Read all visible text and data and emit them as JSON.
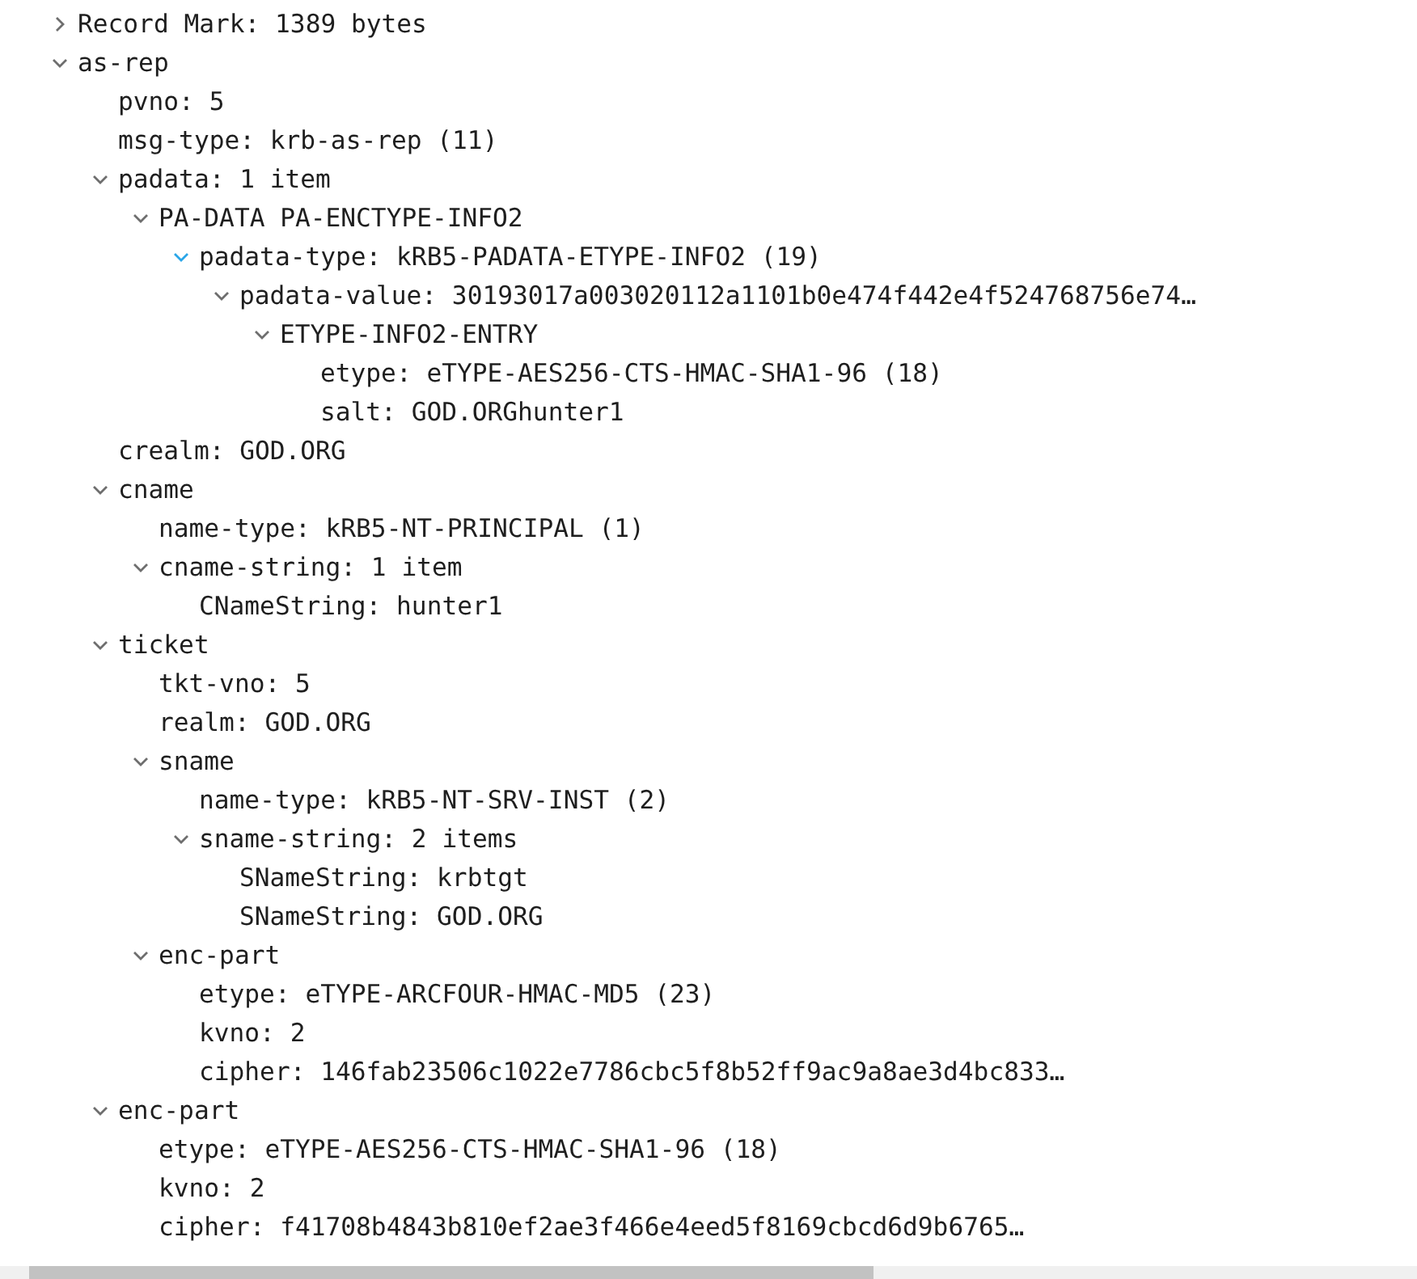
{
  "tree": [
    {
      "label": "Record Mark: 1389 bytes",
      "expanded": false
    },
    {
      "label": "as-rep",
      "expanded": true,
      "children": [
        {
          "label": "pvno: 5"
        },
        {
          "label": "msg-type: krb-as-rep (11)"
        },
        {
          "label": "padata: 1 item",
          "expanded": true,
          "children": [
            {
              "label": "PA-DATA PA-ENCTYPE-INFO2",
              "expanded": true,
              "children": [
                {
                  "label": "padata-type: kRB5-PADATA-ETYPE-INFO2 (19)",
                  "expanded": true,
                  "highlighted": true,
                  "children": [
                    {
                      "label": "padata-value: 30193017a003020112a1101b0e474f442e4f524768756e74…",
                      "expanded": true,
                      "children": [
                        {
                          "label": "ETYPE-INFO2-ENTRY",
                          "expanded": true,
                          "children": [
                            {
                              "label": "etype: eTYPE-AES256-CTS-HMAC-SHA1-96 (18)"
                            },
                            {
                              "label": "salt: GOD.ORGhunter1"
                            }
                          ]
                        }
                      ]
                    }
                  ]
                }
              ]
            }
          ]
        },
        {
          "label": "crealm: GOD.ORG"
        },
        {
          "label": "cname",
          "expanded": true,
          "children": [
            {
              "label": "name-type: kRB5-NT-PRINCIPAL (1)"
            },
            {
              "label": "cname-string: 1 item",
              "expanded": true,
              "children": [
                {
                  "label": "CNameString: hunter1"
                }
              ]
            }
          ]
        },
        {
          "label": "ticket",
          "expanded": true,
          "children": [
            {
              "label": "tkt-vno: 5"
            },
            {
              "label": "realm: GOD.ORG"
            },
            {
              "label": "sname",
              "expanded": true,
              "children": [
                {
                  "label": "name-type: kRB5-NT-SRV-INST (2)"
                },
                {
                  "label": "sname-string: 2 items",
                  "expanded": true,
                  "children": [
                    {
                      "label": "SNameString: krbtgt"
                    },
                    {
                      "label": "SNameString: GOD.ORG"
                    }
                  ]
                }
              ]
            },
            {
              "label": "enc-part",
              "expanded": true,
              "children": [
                {
                  "label": "etype: eTYPE-ARCFOUR-HMAC-MD5 (23)"
                },
                {
                  "label": "kvno: 2"
                },
                {
                  "label": "cipher: 146fab23506c1022e7786cbc5f8b52ff9ac9a8ae3d4bc833…"
                }
              ]
            }
          ]
        },
        {
          "label": "enc-part",
          "expanded": true,
          "children": [
            {
              "label": "etype: eTYPE-AES256-CTS-HMAC-SHA1-96 (18)"
            },
            {
              "label": "kvno: 2"
            },
            {
              "label": "cipher: f41708b4843b810ef2ae3f466e4eed5f8169cbcd6d9b6765…"
            }
          ]
        }
      ]
    }
  ]
}
